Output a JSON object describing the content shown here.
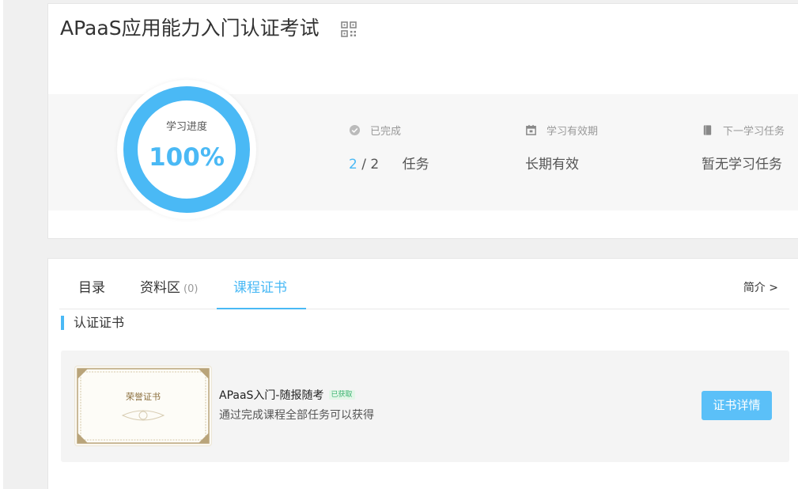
{
  "course": {
    "title": "APaaS应用能力入门认证考试",
    "qr_icon": "qr-code-icon"
  },
  "progress": {
    "label": "学习进度",
    "value_text": "100%",
    "value": 1.0,
    "color": "#4ab9f5"
  },
  "stats": {
    "completed": {
      "icon": "check-circle-icon",
      "label": "已完成",
      "done": "2",
      "separator": "/",
      "total": "2",
      "unit": "任务"
    },
    "validity": {
      "icon": "calendar-icon",
      "label": "学习有效期",
      "value": "长期有效"
    },
    "next_task": {
      "icon": "book-icon",
      "label": "下一学习任务",
      "value": "暂无学习任务"
    }
  },
  "tabs": [
    {
      "label": "目录",
      "count": ""
    },
    {
      "label": "资料区",
      "count": "(0)"
    },
    {
      "label": "课程证书",
      "count": ""
    }
  ],
  "active_tab": 2,
  "intro_link": "简介 >",
  "section": {
    "title": "认证证书"
  },
  "certificate": {
    "thumb_text": "荣誉证书",
    "title": "APaaS入门-随报随考",
    "badge": "已获取",
    "description": "通过完成课程全部任务可以获得",
    "button_label": "证书详情"
  },
  "colors": {
    "accent": "#4ab9f5",
    "button": "#5bc0f8",
    "badge_text": "#3cb371"
  }
}
